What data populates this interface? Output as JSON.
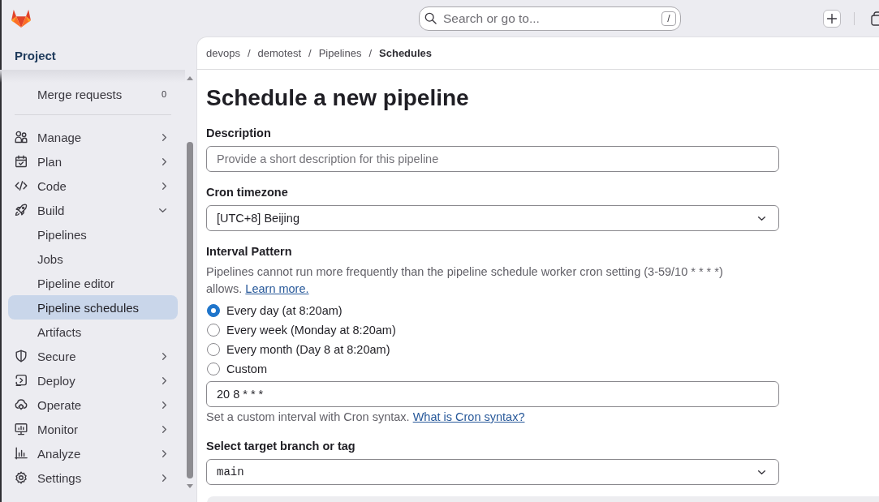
{
  "topbar": {
    "search": {
      "placeholder": "Search or go to...",
      "shortcut": "/"
    }
  },
  "sidebar": {
    "title": "Project",
    "pinned": [
      {
        "label": "Merge requests",
        "count": "0"
      }
    ],
    "items": [
      {
        "label": "Manage",
        "expanded": false
      },
      {
        "label": "Plan",
        "expanded": false
      },
      {
        "label": "Code",
        "expanded": false
      },
      {
        "label": "Build",
        "expanded": true,
        "children": [
          {
            "label": "Pipelines",
            "selected": false
          },
          {
            "label": "Jobs",
            "selected": false
          },
          {
            "label": "Pipeline editor",
            "selected": false
          },
          {
            "label": "Pipeline schedules",
            "selected": true
          },
          {
            "label": "Artifacts",
            "selected": false
          }
        ]
      },
      {
        "label": "Secure",
        "expanded": false
      },
      {
        "label": "Deploy",
        "expanded": false
      },
      {
        "label": "Operate",
        "expanded": false
      },
      {
        "label": "Monitor",
        "expanded": false
      },
      {
        "label": "Analyze",
        "expanded": false
      },
      {
        "label": "Settings",
        "expanded": false
      }
    ]
  },
  "breadcrumb": [
    {
      "label": "devops",
      "current": false,
      "separator": "/"
    },
    {
      "label": "demotest",
      "current": false,
      "separator": "/"
    },
    {
      "label": "Pipelines",
      "current": false,
      "separator": "/"
    },
    {
      "label": "Schedules",
      "current": true
    }
  ],
  "page": {
    "title": "Schedule a new pipeline"
  },
  "form": {
    "fields": [
      {
        "kind": "text",
        "label": "Description",
        "placeholder": "Provide a short description for this pipeline"
      },
      {
        "kind": "select",
        "label": "Cron timezone",
        "value": "[UTC+8] Beijing"
      },
      {
        "kind": "interval",
        "label": "Interval Pattern",
        "help": "Pipelines cannot run more frequently than the pipeline schedule worker cron setting (3-59/10 * * * *) allows.",
        "help_link": "Learn more.",
        "options": [
          {
            "label": "Every day (at 8:20am)",
            "selected": true
          },
          {
            "label": "Every week (Monday at 8:20am)",
            "selected": false
          },
          {
            "label": "Every month (Day 8 at 8:20am)",
            "selected": false
          },
          {
            "label": "Custom",
            "selected": false
          }
        ],
        "custom_value": "20 8 * * *",
        "custom_help": "Set a custom interval with Cron syntax.",
        "custom_link": "What is Cron syntax?"
      },
      {
        "kind": "branch-select",
        "label": "Select target branch or tag",
        "value": "main"
      }
    ]
  }
}
